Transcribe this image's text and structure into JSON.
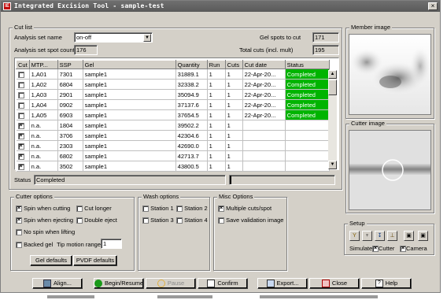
{
  "window": {
    "title": "Integrated Excision Tool - sample-test",
    "app_icon": "IE",
    "close_glyph": "×"
  },
  "cut_list": {
    "legend": "Cut list",
    "analysis_set_name_label": "Analysis set name",
    "analysis_set_name_value": "on-off",
    "gel_spots_label": "Gel spots to cut",
    "gel_spots_value": "171",
    "analysis_spot_count_label": "Analysis set spot count",
    "analysis_spot_count_value": "176",
    "total_cuts_label": "Total cuts (incl. mult)",
    "total_cuts_value": "195",
    "columns": [
      "Cut",
      "MTP...",
      "SSP",
      "Gel",
      "Quantity",
      "Run",
      "Cuts",
      "Cut date",
      "Status"
    ],
    "rows": [
      {
        "cut": "",
        "mtp": "1,A01",
        "ssp": "7301",
        "gel": "sample1",
        "qty": "31889.1",
        "run": "1",
        "cuts": "1",
        "date": "22-Apr-20...",
        "status": "Completed"
      },
      {
        "cut": "",
        "mtp": "1,A02",
        "ssp": "6804",
        "gel": "sample1",
        "qty": "32338.2",
        "run": "1",
        "cuts": "1",
        "date": "22-Apr-20...",
        "status": "Completed"
      },
      {
        "cut": "",
        "mtp": "1,A03",
        "ssp": "2901",
        "gel": "sample1",
        "qty": "35094.9",
        "run": "1",
        "cuts": "1",
        "date": "22-Apr-20...",
        "status": "Completed"
      },
      {
        "cut": "",
        "mtp": "1,A04",
        "ssp": "0902",
        "gel": "sample1",
        "qty": "37137.6",
        "run": "1",
        "cuts": "1",
        "date": "22-Apr-20...",
        "status": "Completed"
      },
      {
        "cut": "",
        "mtp": "1,A05",
        "ssp": "6903",
        "gel": "sample1",
        "qty": "37654.5",
        "run": "1",
        "cuts": "1",
        "date": "22-Apr-20...",
        "status": "Completed"
      },
      {
        "cut": "x",
        "mtp": "n.a.",
        "ssp": "1804",
        "gel": "sample1",
        "qty": "39502.2",
        "run": "1",
        "cuts": "1",
        "date": "",
        "status": ""
      },
      {
        "cut": "x",
        "mtp": "n.a.",
        "ssp": "3706",
        "gel": "sample1",
        "qty": "42304.6",
        "run": "1",
        "cuts": "1",
        "date": "",
        "status": ""
      },
      {
        "cut": "x",
        "mtp": "n.a.",
        "ssp": "2303",
        "gel": "sample1",
        "qty": "42690.0",
        "run": "1",
        "cuts": "1",
        "date": "",
        "status": ""
      },
      {
        "cut": "x",
        "mtp": "n.a.",
        "ssp": "6802",
        "gel": "sample1",
        "qty": "42713.7",
        "run": "1",
        "cuts": "1",
        "date": "",
        "status": ""
      },
      {
        "cut": "x",
        "mtp": "n.a.",
        "ssp": "3502",
        "gel": "sample1",
        "qty": "43800.5",
        "run": "1",
        "cuts": "1",
        "date": "",
        "status": ""
      }
    ],
    "status_label": "Status",
    "status_value": "Completed"
  },
  "member_image": {
    "legend": "Member image"
  },
  "cutter_image": {
    "legend": "Cutter image"
  },
  "cutter_options": {
    "legend": "Cutter options",
    "spin_cutting": "Spin when cutting",
    "cut_longer": "Cut longer",
    "spin_ejecting": "Spin when ejecting",
    "double_eject": "Double eject",
    "no_spin_lifting": "No spin when lifting",
    "backed_gel": "Backed gel",
    "tip_motion_label": "Tip motion range",
    "tip_motion_value": "1",
    "gel_defaults": "Gel defaults",
    "pvdf_defaults": "PVDF defaults"
  },
  "wash_options": {
    "legend": "Wash options",
    "station1": "Station 1",
    "station2": "Station 2",
    "station3": "Station 3",
    "station4": "Station 4"
  },
  "misc_options": {
    "legend": "Misc Options",
    "multiple_cuts": "Multiple cuts/spot",
    "save_validation": "Save validation image"
  },
  "setup": {
    "legend": "Setup",
    "simulate": "Simulate",
    "cutter": "Cutter",
    "camera": "Camera"
  },
  "buttons": {
    "align": "Align...",
    "begin_resume": "Begin/Resume",
    "pause": "Pause",
    "confirm": "Confirm",
    "export": "Export...",
    "close": "Close",
    "help": "Help"
  },
  "colors": {
    "completed": "#00b400",
    "chrome": "#d4d0c8"
  }
}
